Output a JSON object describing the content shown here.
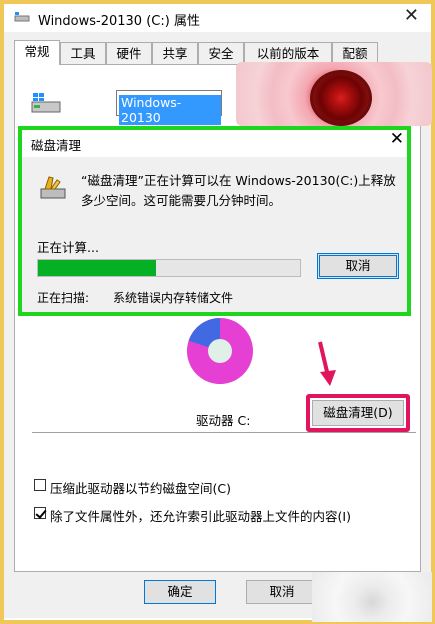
{
  "window": {
    "title": "Windows-20130 (C:) 属性",
    "close_glyph": "✕"
  },
  "tabs": [
    {
      "label": "常规",
      "active": true
    },
    {
      "label": "工具",
      "active": false
    },
    {
      "label": "硬件",
      "active": false
    },
    {
      "label": "共享",
      "active": false
    },
    {
      "label": "安全",
      "active": false
    },
    {
      "label": "以前的版本",
      "active": false
    },
    {
      "label": "配额",
      "active": false
    }
  ],
  "general": {
    "drive_name_value": "Windows-20130",
    "drive_label": "驱动器 C:",
    "cleanup_button": "磁盘清理(D)",
    "usage": {
      "used_color": "#4169e1",
      "free_color": "#e53fd4",
      "free_fraction": 0.8
    },
    "compress_checkbox": {
      "label": "压缩此驱动器以节约磁盘空间(C)",
      "checked": false
    },
    "index_checkbox": {
      "label": "除了文件属性外，还允许索引此驱动器上文件的内容(I)",
      "checked": true
    }
  },
  "buttons": {
    "ok": "确定",
    "cancel": "取消"
  },
  "disk_cleanup_dialog": {
    "title": "磁盘清理",
    "close_glyph": "✕",
    "message": "“磁盘清理”正在计算可以在 Windows-20130(C:)上释放多少空间。这可能需要几分钟时间。",
    "status": "正在计算...",
    "progress_percent": 45,
    "cancel_button": "取消",
    "scanning_label": "正在扫描:",
    "scanning_value": "系统错误内存转储文件"
  },
  "annotations": {
    "green_highlight": "#1fd61f",
    "red_highlight": "#e0155e"
  }
}
